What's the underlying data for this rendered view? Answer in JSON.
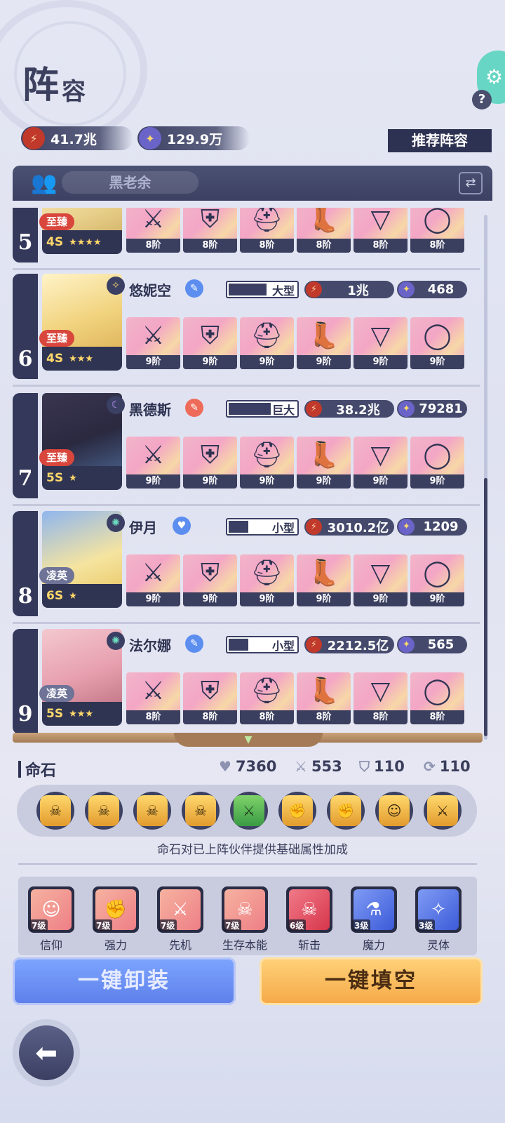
{
  "header": {
    "title_big": "阵",
    "title_small": "容",
    "help_icon": "?",
    "power_value": "41.7兆",
    "points_value": "129.9万",
    "recommend_label": "推荐阵容"
  },
  "team": {
    "name": "黑老余"
  },
  "heroes": [
    {
      "rank": "5",
      "name": "",
      "rarity": "至臻",
      "level": "4S",
      "stars": "★★★★",
      "size": "",
      "power": "",
      "score": "",
      "gear_icons": [
        "⚔",
        "⛨",
        "⛑",
        "👢",
        "▽",
        "◯"
      ],
      "gear_levels": [
        "8阶",
        "8阶",
        "8阶",
        "8阶",
        "8阶",
        "8阶"
      ]
    },
    {
      "rank": "6",
      "name": "悠妮空",
      "rarity": "至臻",
      "level": "4S",
      "stars": "★★★",
      "size": "大型",
      "size_fill": 0.6,
      "power": "1兆",
      "score": "468",
      "gear_icons": [
        "⚔",
        "⛨",
        "⛑",
        "👢",
        "▽",
        "◯"
      ],
      "gear_levels": [
        "9阶",
        "9阶",
        "9阶",
        "9阶",
        "9阶",
        "9阶"
      ]
    },
    {
      "rank": "7",
      "name": "黑德斯",
      "rarity": "至臻",
      "level": "5S",
      "stars": "★",
      "size": "巨大",
      "size_fill": 0.65,
      "power": "38.2兆",
      "score": "79281",
      "gear_icons": [
        "⚔",
        "⛨",
        "⛑",
        "👢",
        "▽",
        "◯"
      ],
      "gear_levels": [
        "9阶",
        "9阶",
        "9阶",
        "9阶",
        "9阶",
        "9阶"
      ]
    },
    {
      "rank": "8",
      "name": "伊月",
      "rarity": "凌英",
      "level": "6S",
      "stars": "★",
      "size": "小型",
      "size_fill": 0.3,
      "power": "3010.2亿",
      "score": "1209",
      "gear_icons": [
        "⚔",
        "⛨",
        "⛑",
        "👢",
        "▽",
        "◯"
      ],
      "gear_levels": [
        "9阶",
        "9阶",
        "9阶",
        "9阶",
        "9阶",
        "9阶"
      ]
    },
    {
      "rank": "9",
      "name": "法尔娜",
      "rarity": "凌英",
      "level": "5S",
      "stars": "★★★",
      "size": "小型",
      "size_fill": 0.3,
      "power": "2212.5亿",
      "score": "565",
      "gear_icons": [
        "⚔",
        "⛨",
        "⛑",
        "👢",
        "▽",
        "◯"
      ],
      "gear_levels": [
        "8阶",
        "8阶",
        "8阶",
        "8阶",
        "8阶",
        "8阶"
      ]
    }
  ],
  "stones": {
    "title": "命石",
    "stat1": "7360",
    "stat2": "553",
    "stat3": "110",
    "stat4": "110",
    "note": "命石对已上阵伙伴提供基础属性加成"
  },
  "runes": [
    {
      "level": "7级",
      "name": "信仰",
      "color": "#f39a6e"
    },
    {
      "level": "7级",
      "name": "强力",
      "color": "#f39a6e"
    },
    {
      "level": "7级",
      "name": "先机",
      "color": "#f39a6e"
    },
    {
      "level": "7级",
      "name": "生存本能",
      "color": "#f39a6e"
    },
    {
      "level": "6级",
      "name": "斩击",
      "color": "#ec4f63"
    },
    {
      "level": "3级",
      "name": "魔力",
      "color": "#4d6ee6"
    },
    {
      "level": "3级",
      "name": "灵体",
      "color": "#4d6ee6"
    }
  ],
  "actions": {
    "unequip": "一键卸装",
    "fill": "一键填空"
  }
}
